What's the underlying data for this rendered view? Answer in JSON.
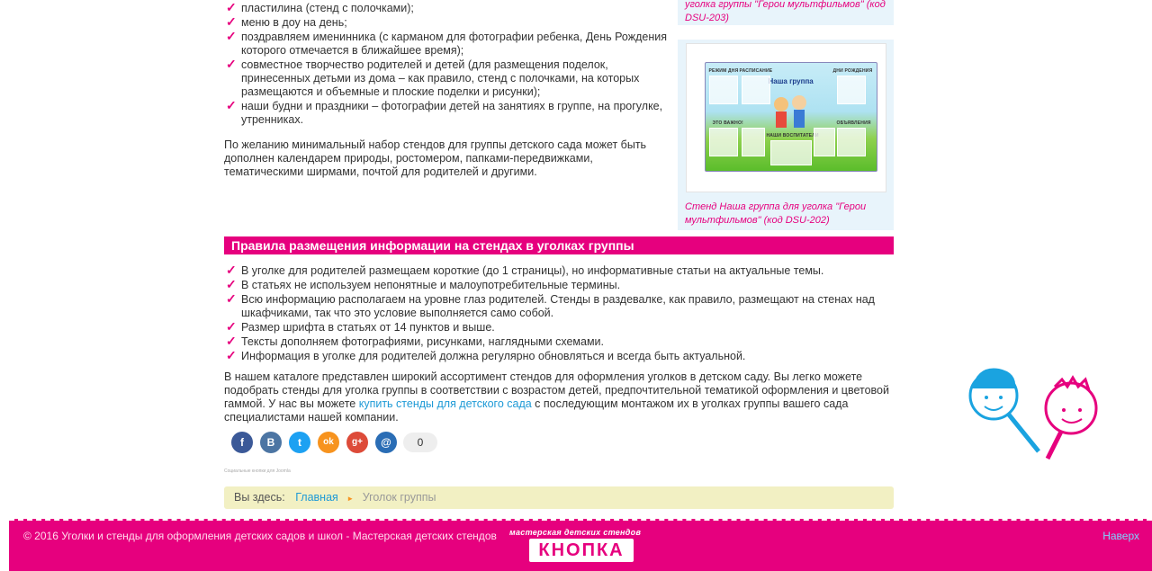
{
  "top_list": [
    "пластилина (стенд с полочками);",
    "меню в доу на день;",
    "поздравляем именинника (с карманом для фотографии ребенка, День Рождения которого отмечается в ближайшее время);",
    "совместное творчество родителей и детей (для размещения поделок, принесенных детьми из дома – как правило, стенд с полочками, на которых размещаются и объемные и плоские поделки и рисунки);",
    "наши будни и праздники – фотографии детей на занятиях в группе, на прогулке, утренниках."
  ],
  "intro_para": "По желанию минимальный набор стендов для группы детского сада может быть дополнен календарем природы, ростомером, папками-передвижками, тематическими ширмами, почтой для родителей и другими.",
  "card1_caption": "уголка группы \"Герои мультфильмов\" (код DSU-203)",
  "card2_caption": "Стенд Наша группа для уголка \"Герои мультфильмов\" (код DSU-202)",
  "stand": {
    "title": "Наша группа",
    "label_mode": "РЕЖИМ ДНЯ",
    "label_schedule": "РАСПИСАНИЕ",
    "label_birthdays": "ДНИ РОЖДЕНИЯ",
    "label_important": "ЭТО ВАЖНО!",
    "label_teachers": "НАШИ ВОСПИТАТЕЛИ",
    "label_ads": "ОБЪЯВЛЕНИЯ"
  },
  "section_title": "Правила размещения информации на стендах в уголках группы",
  "rules": [
    "В уголке для родителей размещаем короткие (до 1 страницы), но информативные статьи на актуальные темы.",
    "В статьях не используем непонятные и малоупотребительные термины.",
    "Всю информацию располагаем на уровне глаз родителей. Стенды в раздевалке, как правило, размещают на стенах над шкафчиками, так что это условие выполняется само собой.",
    "Размер шрифта в статьях от 14 пунктов и выше.",
    "Тексты дополняем фотографиями, рисунками, наглядными схемами.",
    "Информация в уголке для родителей должна регулярно обновляться и всегда быть актуальной."
  ],
  "catalog": {
    "before": "В нашем каталоге представлен широкий ассортимент стендов для оформления уголков в детском саду. Вы легко можете подобрать стенды для уголка группы в соответствии с возрастом детей, предпочтительной тематикой оформления и цветовой гаммой. У нас вы можете ",
    "link": "купить стенды для детского сада",
    "after": " с последующим монтажом их в уголках группы вашего сада специалистами нашей компании."
  },
  "share": {
    "count": "0",
    "facebook": "f",
    "vk": "B",
    "twitter": "t",
    "ok": "ok",
    "gplus": "g+",
    "email": "@"
  },
  "tiny_note": "Социальные кнопки для Joomla",
  "breadcrumbs": {
    "label": "Вы здесь:",
    "home": "Главная",
    "current": "Уголок группы",
    "sep": "►"
  },
  "footer": {
    "copyright": "© 2016 Уголки и стенды для оформления детских садов и школ - Мастерская детских стендов",
    "logo_tagline": "мастерская детских стендов",
    "logo_name": "КНОПКА",
    "to_top": "Наверх"
  },
  "colors": {
    "accent": "#e6007e",
    "link": "#1e9ad6",
    "crumbs_bg": "#f2f0c3",
    "card_bg": "#e8f4fb"
  },
  "check_glyph": "✓"
}
